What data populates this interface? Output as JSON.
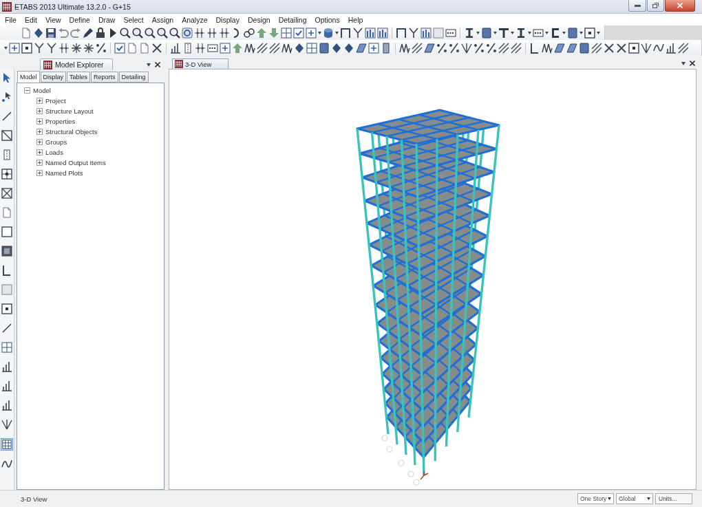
{
  "window": {
    "title": "ETABS 2013 Ultimate 13.2.0 - G+15"
  },
  "menu_bar": [
    "File",
    "Edit",
    "View",
    "Define",
    "Draw",
    "Select",
    "Assign",
    "Analyze",
    "Display",
    "Design",
    "Detailing",
    "Options",
    "Help"
  ],
  "side_toolbar": {
    "toggle_button": {
      "on": true
    }
  },
  "model_explorer": {
    "title": "Model Explorer",
    "tabs": [
      {
        "label": "Model",
        "selected": true
      },
      {
        "label": "Display",
        "selected": false
      },
      {
        "label": "Tables",
        "selected": false
      },
      {
        "label": "Reports",
        "selected": false
      },
      {
        "label": "Detailing",
        "selected": false
      }
    ],
    "tree": [
      {
        "label": "Model",
        "expanded": true,
        "children": [
          {
            "label": "Project",
            "expanded": false
          },
          {
            "label": "Structure Layout",
            "expanded": false
          },
          {
            "label": "Properties",
            "expanded": false
          },
          {
            "label": "Structural Objects",
            "expanded": false
          },
          {
            "label": "Groups",
            "expanded": false
          },
          {
            "label": "Loads",
            "expanded": false
          },
          {
            "label": "Named Output Items",
            "expanded": false
          },
          {
            "label": "Named Plots",
            "expanded": false
          }
        ]
      }
    ]
  },
  "view_window": {
    "tab": "3-D View"
  },
  "status_bar": {
    "view_name": "3-D View",
    "story_dropdown": "One Story",
    "coordinate_dropdown": "Global",
    "units_button": "Units..."
  }
}
